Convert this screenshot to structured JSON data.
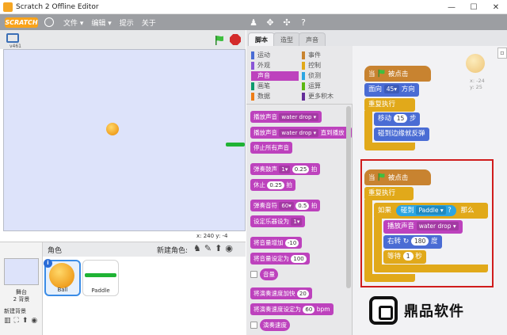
{
  "window": {
    "title": "Scratch 2 Offline Editor",
    "minimize": "—",
    "maximize": "☐",
    "close": "✕"
  },
  "menubar": {
    "logo": "SCRATCH",
    "items": [
      "文件 ▾",
      "编辑 ▾",
      "提示",
      "关于"
    ],
    "toolbar_icons": [
      "stamp-icon",
      "grow-icon",
      "shrink-icon",
      "help-icon"
    ]
  },
  "stage": {
    "version": "v461",
    "coords": "x: 240  y: -4"
  },
  "sprites": {
    "title": "角色",
    "new_sprite_label": "新建角色:",
    "stage_label": "舞台",
    "stage_backdrops": "2 背景",
    "new_backdrop_label": "新建背景",
    "items": [
      {
        "name": "Ball",
        "selected": true
      },
      {
        "name": "Paddle",
        "selected": false
      }
    ]
  },
  "tabs": [
    {
      "label": "脚本",
      "active": true
    },
    {
      "label": "造型",
      "active": false
    },
    {
      "label": "声音",
      "active": false
    }
  ],
  "categories": {
    "left": [
      {
        "label": "运动",
        "color": "#4a6cd4"
      },
      {
        "label": "外观",
        "color": "#8a55d7"
      },
      {
        "label": "声音",
        "color": "#bd42bd",
        "active": true
      },
      {
        "label": "画笔",
        "color": "#0e9a6c"
      },
      {
        "label": "数据",
        "color": "#ee7d16"
      }
    ],
    "right": [
      {
        "label": "事件",
        "color": "#c88330"
      },
      {
        "label": "控制",
        "color": "#e1a91a"
      },
      {
        "label": "侦测",
        "color": "#2ca5e2"
      },
      {
        "label": "运算",
        "color": "#5cb712"
      },
      {
        "label": "更多积木",
        "color": "#632d99"
      }
    ]
  },
  "palette_blocks": {
    "play_sound": "播放声音",
    "play_sound_value": "water drop ▾",
    "play_until_done": "播放声音",
    "play_until_done_value": "water drop ▾",
    "play_until_done_suffix": "直到播放",
    "stop_all_sounds": "停止所有声音",
    "play_drum": "弹奏鼓声",
    "play_drum_value": "1▾",
    "play_drum_beats": "0.25",
    "play_drum_suffix": "拍",
    "rest_for": "休止",
    "rest_value": "0.25",
    "rest_suffix": "拍",
    "play_note": "弹奏音符",
    "play_note_value": "60▾",
    "play_note_beats": "0.5",
    "play_note_suffix": "拍",
    "set_instrument": "设定乐器设为",
    "set_instrument_value": "1▾",
    "change_volume": "将音量增加",
    "change_volume_value": "-10",
    "set_volume": "将音量设定为",
    "set_volume_value": "100",
    "volume_reporter": "音量",
    "change_tempo": "将演奏速度加快",
    "change_tempo_value": "20",
    "set_tempo": "将演奏速度设定为",
    "set_tempo_value": "60",
    "set_tempo_unit": "bpm",
    "tempo_reporter": "演奏速度"
  },
  "sprite_info": {
    "x": "x: -24",
    "y": "y: 25"
  },
  "script1": {
    "hat_when": "当",
    "hat_clicked": "被点击",
    "point_dir": "面向",
    "point_dir_value": "45▾",
    "point_dir_suffix": "方向",
    "forever": "重复执行",
    "move": "移动",
    "move_value": "15",
    "move_suffix": "步",
    "bounce": "碰到边缘就反弹"
  },
  "script2": {
    "hat_when": "当",
    "hat_clicked": "被点击",
    "forever": "重复执行",
    "if": "如果",
    "then": "那么",
    "touching": "碰到",
    "touching_target": "Paddle ▾",
    "touching_q": "?",
    "play_sound": "播放声音",
    "play_sound_value": "water drop ▾",
    "turn_right": "右转",
    "turn_value": "180",
    "turn_suffix": "度",
    "wait": "等待",
    "wait_value": "1",
    "wait_suffix": "秒"
  },
  "watermark": {
    "text": "鼎品软件"
  },
  "colors": {
    "menubar": "#9c9ea2",
    "stage_bg": "#dde3fa",
    "sound": "#bd42bd",
    "events": "#c88330",
    "control": "#e1a91a",
    "motion": "#4a6cd4",
    "sensing": "#2ca5e2",
    "highlight": "#d01c1c"
  }
}
